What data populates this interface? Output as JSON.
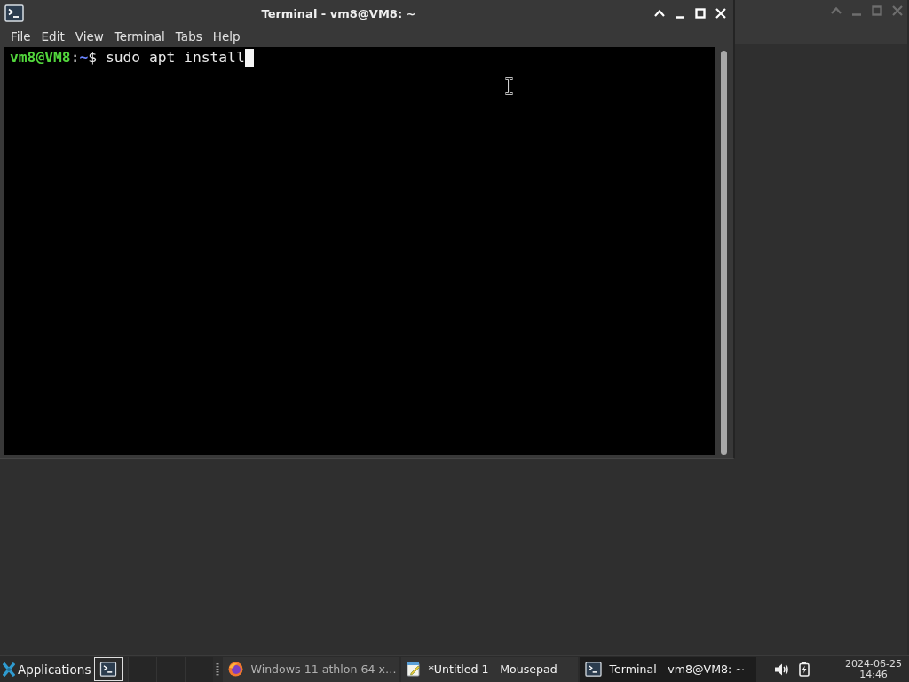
{
  "window": {
    "title": "Terminal - vm8@VM8: ~"
  },
  "menu": [
    "File",
    "Edit",
    "View",
    "Terminal",
    "Tabs",
    "Help"
  ],
  "terminal": {
    "lines": [
      {
        "user_host": "vm8@VM8",
        "separator": ":",
        "path": "~",
        "symbol": "$",
        "command": "sudo apt install",
        "cursor": true
      }
    ]
  },
  "taskbar": {
    "menu_button": "Applications",
    "tasks": [
      {
        "kind": "browser",
        "label": "Windows 11 athlon 64 x…",
        "minimized": true,
        "selected": false
      },
      {
        "kind": "editor",
        "label": "*Untitled 1 - Mousepad",
        "minimized": false,
        "selected": false
      },
      {
        "kind": "terminal",
        "label": "Terminal - vm8@VM8: ~",
        "minimized": false,
        "selected": true
      }
    ],
    "clock": {
      "date": "2024-06-25",
      "time": "14:46"
    }
  }
}
